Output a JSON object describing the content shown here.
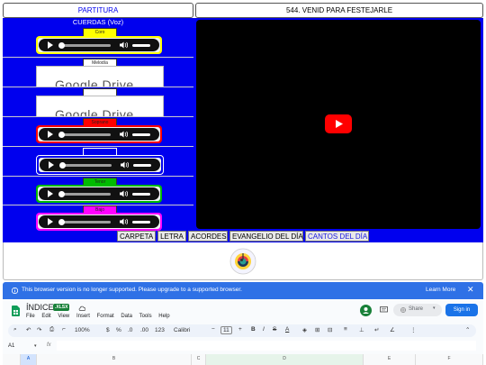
{
  "header": {
    "left_title": "PARTITURA",
    "right_title": "544. VENID PARA FESTEJARLE"
  },
  "voices": {
    "section_title": "CUERDAS (Voz)",
    "rows": [
      {
        "label": "Coro",
        "type": "player",
        "color": "#ffff00"
      },
      {
        "label": "Melodía",
        "type": "drive",
        "color": "#ffffff"
      },
      {
        "label": "",
        "type": "drive",
        "color": "#ffffff"
      },
      {
        "label": "Soprano",
        "type": "player",
        "color": "#ff0000"
      },
      {
        "label": "",
        "type": "player",
        "color": "#0000ee"
      },
      {
        "label": "Tenor",
        "type": "player",
        "color": "#00bb00"
      },
      {
        "label": "Bajo",
        "type": "player",
        "color": "#ff00ff"
      }
    ],
    "drive_text": "Google Drive"
  },
  "nav": {
    "buttons": [
      "CARPETA",
      "LETRA",
      "ACORDES",
      "EVANGELIO DEL DÍA",
      "CANTOS DEL DÍA"
    ]
  },
  "banner": {
    "message": "This browser version is no longer supported. Please upgrade to a supported browser.",
    "learn_more": "Learn More",
    "close": "✕"
  },
  "sheets": {
    "doc_title": "ÍNDICE",
    "badge": ".XLSX",
    "menu": [
      "File",
      "Edit",
      "View",
      "Insert",
      "Format",
      "Data",
      "Tools",
      "Help"
    ],
    "share_label": "Share",
    "signin_label": "Sign in",
    "zoom": "100%",
    "font": "Calibri",
    "font_size": "11",
    "cell_ref": "A1",
    "currency": "$",
    "percent": "%",
    "num_format": "123",
    "columns": [
      "A",
      "B",
      "C",
      "D",
      "E",
      "F"
    ]
  },
  "colors": {
    "panel_blue": "#0000ee",
    "banner_blue": "#2f71e6",
    "youtube_red": "#ff0000"
  }
}
